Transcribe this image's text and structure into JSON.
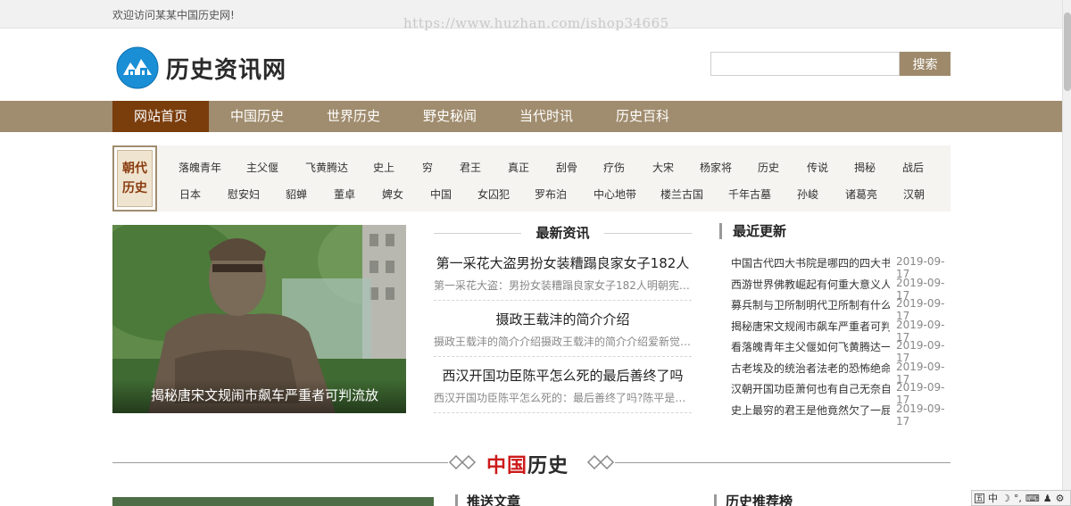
{
  "topbar": {
    "welcome": "欢迎访问某某中国历史网!",
    "watermark": "https://www.huzhan.com/ishop34665"
  },
  "header": {
    "site_name": "历史资讯网",
    "search_placeholder": "",
    "search_button": "搜索"
  },
  "nav": {
    "items": [
      {
        "label": "网站首页",
        "active": true
      },
      {
        "label": "中国历史",
        "active": false
      },
      {
        "label": "世界历史",
        "active": false
      },
      {
        "label": "野史秘闻",
        "active": false
      },
      {
        "label": "当代时讯",
        "active": false
      },
      {
        "label": "历史百科",
        "active": false
      }
    ]
  },
  "dynasty": {
    "badge": "朝代历史",
    "row1": [
      "落魄青年",
      "主父偃",
      "飞黄腾达",
      "史上",
      "穷",
      "君王",
      "真正",
      "刮骨",
      "疗伤",
      "大宋",
      "杨家将",
      "历史",
      "传说",
      "揭秘",
      "战后"
    ],
    "row2": [
      "日本",
      "慰安妇",
      "貂蝉",
      "董卓",
      "婢女",
      "中国",
      "女囚犯",
      "罗布泊",
      "中心地带",
      "楼兰古国",
      "千年古墓",
      "孙峻",
      "诸葛亮",
      "汉朝"
    ]
  },
  "feature": {
    "caption": "揭秘唐宋文规闹市飙车严重者可判流放"
  },
  "latest_news": {
    "title": "最新资讯",
    "items": [
      {
        "headline": "第一采花大盗男扮女装糟蹋良家女子182人",
        "summary": "第一采花大盗：男扮女装糟蹋良家女子182人明朝宪宗…"
      },
      {
        "headline": "摄政王载沣的简介介绍",
        "summary": "摄政王载沣的简介介绍摄政王载沣的简介介绍爱新觉罗…"
      },
      {
        "headline": "西汉开国功臣陈平怎么死的最后善终了吗",
        "summary": "西汉开国功臣陈平怎么死的：最后善终了吗?陈平是西汉…"
      }
    ]
  },
  "recent": {
    "title": "最近更新",
    "items": [
      {
        "title": "中国古代四大书院是哪四的四大书院",
        "date": "2019-09-17"
      },
      {
        "title": "西游世界佛教崛起有何重大意义人类",
        "date": "2019-09-17"
      },
      {
        "title": "募兵制与卫所制明代卫所制有什么缺",
        "date": "2019-09-17"
      },
      {
        "title": "揭秘唐宋文规闹市飙车严重者可判流",
        "date": "2019-09-17"
      },
      {
        "title": "看落魄青年主父偃如何飞黄腾达一年",
        "date": "2019-09-17"
      },
      {
        "title": "古老埃及的统治者法老的恐怖绝命诅",
        "date": "2019-09-17"
      },
      {
        "title": "汉朝开国功臣萧何也有自己无奈自污",
        "date": "2019-09-17"
      },
      {
        "title": "史上最穷的君王是他竟然欠了一屁股",
        "date": "2019-09-17"
      }
    ]
  },
  "section": {
    "title_red": "中国",
    "title_dark": "历史"
  },
  "bottom": {
    "recommend": "推送文章",
    "ranking": "历史推荐榜"
  },
  "ime": {
    "lang": "中"
  },
  "colors": {
    "nav_bg": "#a08c6e",
    "nav_active": "#7a3d0c",
    "search_button": "#9e8a6b",
    "section_red": "#cc1a1a"
  }
}
